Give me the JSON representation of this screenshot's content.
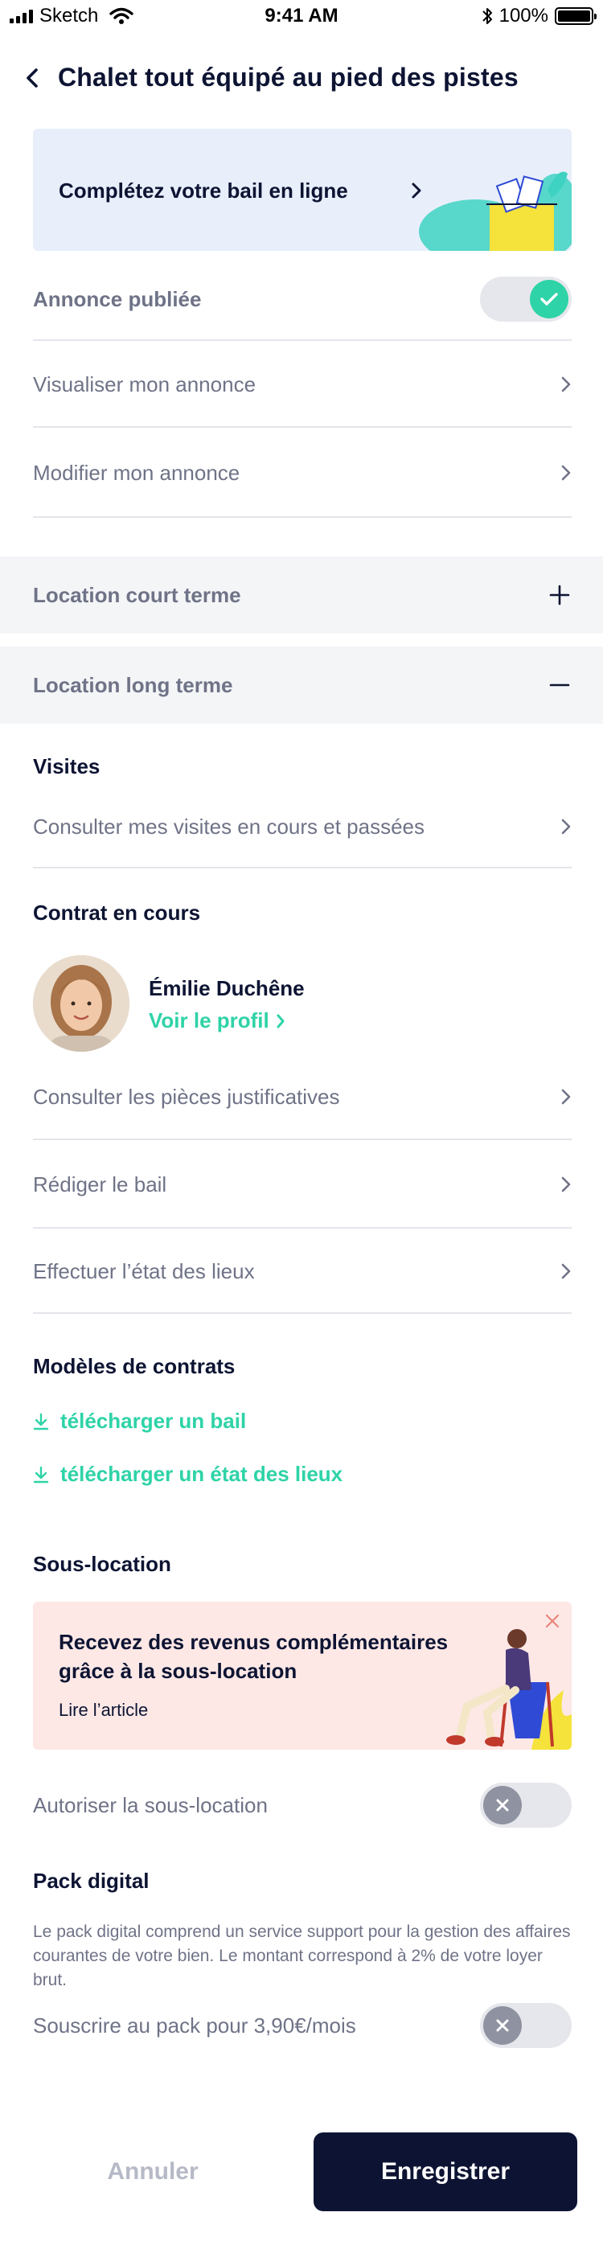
{
  "status_bar": {
    "carrier": "Sketch",
    "time": "9:41 AM",
    "battery": "100%"
  },
  "header": {
    "title": "Chalet tout équipé au pied des pistes"
  },
  "lease_banner": {
    "label": "Complétez votre bail en ligne"
  },
  "listing": {
    "published_label": "Annonce publiée",
    "published": true,
    "view_label": "Visualiser mon annonce",
    "edit_label": "Modifier mon annonce"
  },
  "accordions": {
    "short_term": "Location court terme",
    "long_term": "Location long terme"
  },
  "visits": {
    "title": "Visites",
    "link": "Consulter mes visites en cours et passées"
  },
  "contract": {
    "title": "Contrat en cours",
    "tenant_name": "Émilie Duchêne",
    "profile_link": "Voir le profil",
    "documents": "Consulter les pièces justificatives",
    "draft_lease": "Rédiger le bail",
    "inventory": "Effectuer l’état des lieux"
  },
  "templates": {
    "title": "Modèles de contrats",
    "download_lease": "télécharger un bail",
    "download_inventory": "télécharger un état des lieux"
  },
  "sublet": {
    "title": "Sous-location",
    "banner_title": "Recevez des revenus complémentaires grâce à la sous-location",
    "banner_link": "Lire l’article",
    "allow_label": "Autoriser la sous-location",
    "allowed": false
  },
  "pack": {
    "title": "Pack digital",
    "description": "Le pack digital comprend un service support pour la gestion des affaires courantes de votre bien. Le montant correspond à 2% de votre loyer brut.",
    "subscribe_label": "Souscrire au pack pour 3,90€/mois",
    "subscribed": false
  },
  "footer": {
    "cancel": "Annuler",
    "save": "Enregistrer"
  },
  "colors": {
    "accent": "#2ed3a7",
    "navy": "#0d1433",
    "muted": "#6f7387",
    "banner_blue": "#e8effb",
    "banner_pink": "#fde8e6"
  }
}
